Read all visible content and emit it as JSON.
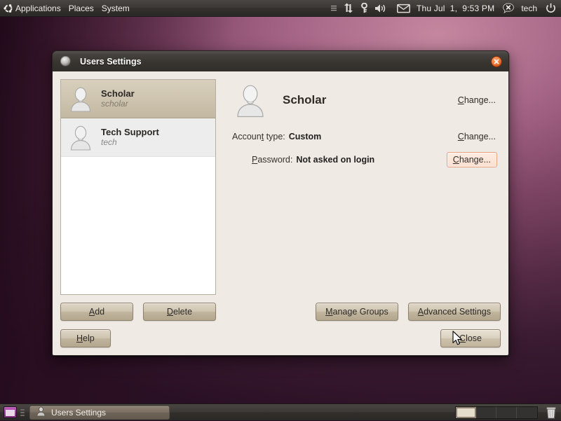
{
  "top_panel": {
    "logo_icon": "ubuntu-logo-icon",
    "menus": [
      "Applications",
      "Places",
      "System"
    ],
    "indicators": [
      {
        "icon": "menu-grip-icon",
        "name": "indicator-applet-grip"
      },
      {
        "icon": "network-updown-icon",
        "name": "network-indicator"
      },
      {
        "icon": "key-icon",
        "name": "keyring-indicator"
      },
      {
        "icon": "volume-speaker-icon",
        "name": "volume-indicator"
      },
      {
        "icon": "envelope-icon",
        "name": "messaging-indicator"
      }
    ],
    "clock": "Thu Jul  1,  9:53 PM",
    "status_icon": "chat-offline-x-icon",
    "username": "tech",
    "power_icon": "power-icon"
  },
  "window": {
    "title": "Users Settings",
    "window_icon": "window-menu-icon",
    "close_icon": "close-icon"
  },
  "user_list": [
    {
      "full_name": "Scholar",
      "login": "scholar",
      "avatar": "user-avatar-icon",
      "selected": true
    },
    {
      "full_name": "Tech Support",
      "login": "tech",
      "avatar": "user-avatar-icon",
      "selected": false
    }
  ],
  "detail": {
    "avatar": "user-avatar-large-icon",
    "name": "Scholar",
    "name_change_label": "Change...",
    "account_type_label": "Account type:",
    "account_type_value": "Custom",
    "account_type_change_label": "Change...",
    "password_label": "Password:",
    "password_value": "Not asked on login",
    "password_change_label": "Change..."
  },
  "buttons": {
    "add": "Add",
    "delete": "Delete",
    "manage_groups": "Manage Groups",
    "advanced_settings": "Advanced Settings",
    "help": "Help",
    "close": "Close"
  },
  "bottom_panel": {
    "show_desktop_icon": "show-desktop-icon",
    "task": {
      "icon": "users-settings-task-icon",
      "label": "Users Settings"
    },
    "workspaces": [
      {
        "active": true
      },
      {
        "active": false
      },
      {
        "active": false
      },
      {
        "active": false
      }
    ],
    "trash_icon": "trash-icon"
  },
  "colors": {
    "dialog_bg": "#efeae3",
    "selection": "#cdc3ae",
    "button_face": "#cfc5b1",
    "focus_border": "#e5a280",
    "focus_fill": "#fbe0d1",
    "panel_bg": "#3b3835",
    "close_button": "#ef7b3c",
    "wallpaper": "#7d4464"
  }
}
